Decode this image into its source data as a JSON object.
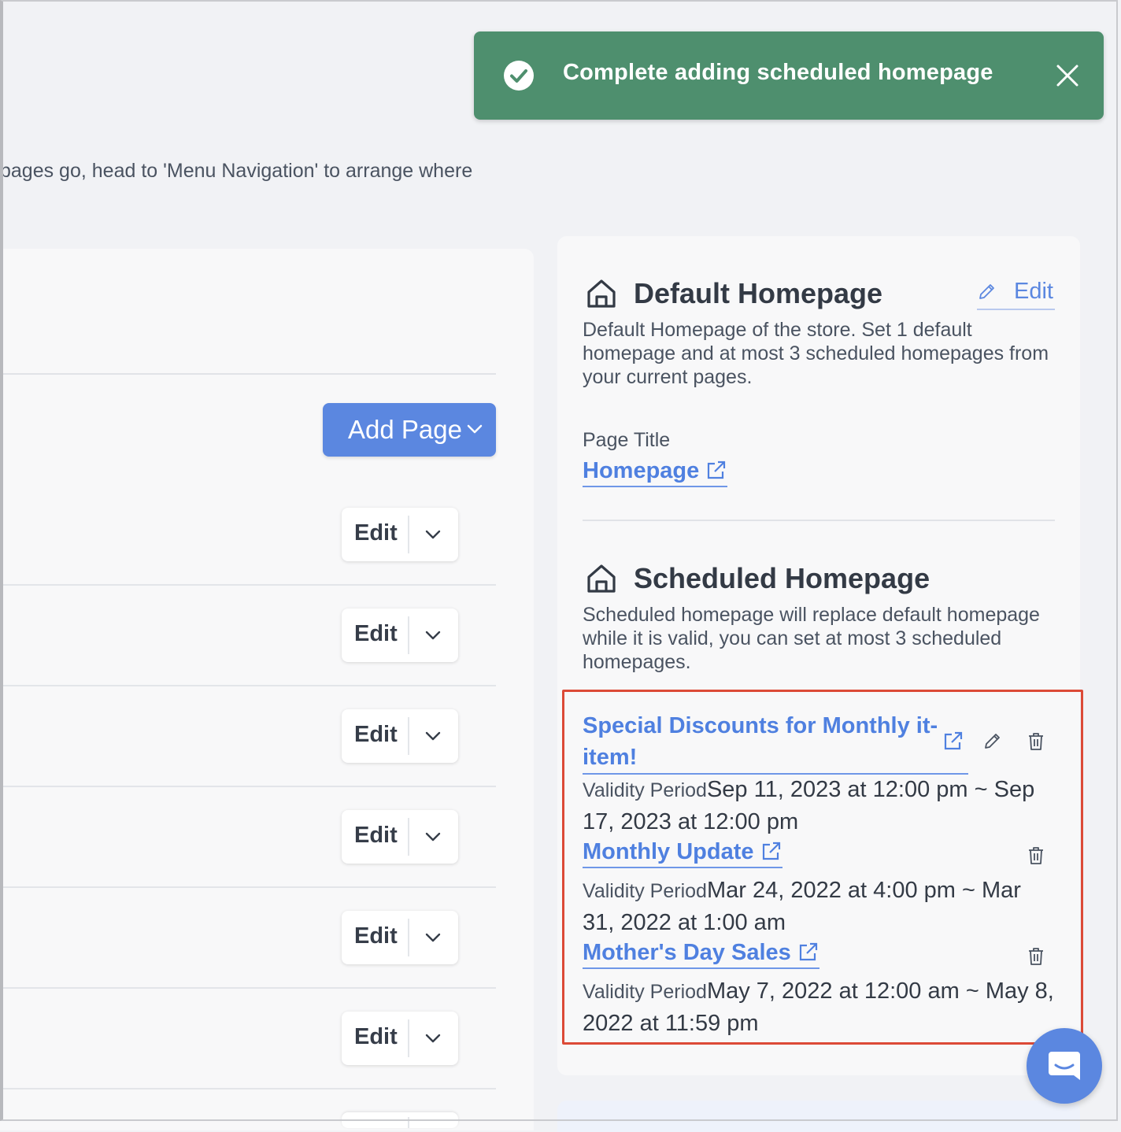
{
  "toast": {
    "message": "Complete adding scheduled homepage",
    "icon": "check-circle-icon",
    "color": "#4e8f6e"
  },
  "intro_text": "pages go, head to 'Menu Navigation' to arrange where",
  "pages_panel": {
    "add_page_label": "Add Page",
    "rows": [
      {
        "edit_label": "Edit"
      },
      {
        "edit_label": "Edit"
      },
      {
        "edit_label": "Edit"
      },
      {
        "edit_label": "Edit"
      },
      {
        "edit_label": "Edit"
      },
      {
        "edit_label": "Edit"
      }
    ]
  },
  "default_homepage": {
    "title": "Default Homepage",
    "edit_label": "Edit",
    "description": "Default Homepage of the store. Set 1 default homepage and at most 3 scheduled homepages from your current pages.",
    "page_title_label": "Page Title",
    "page_link": "Homepage"
  },
  "scheduled_homepage": {
    "title": "Scheduled Homepage",
    "description": "Scheduled homepage will replace default homepage while it is valid, you can set at most 3 scheduled homepages.",
    "items": [
      {
        "title": "Special Discounts for Monthly it-item!",
        "validity_label": "Validity Period",
        "validity": "Sep 11, 2023 at 12:00 pm ~ Sep 17, 2023 at 12:00 pm"
      },
      {
        "title": "Monthly Update",
        "validity_label": "Validity Period",
        "validity": "Mar 24, 2022 at 4:00 pm ~ Mar 31, 2022 at 1:00 am"
      },
      {
        "title": "Mother's Day Sales",
        "validity_label": "Validity Period",
        "validity": "May 7, 2022 at 12:00 am ~ May 8, 2022 at 11:59 pm"
      }
    ]
  },
  "colors": {
    "accent": "#5b87e0",
    "link": "#4f80e0",
    "highlight": "#dc4a37"
  }
}
